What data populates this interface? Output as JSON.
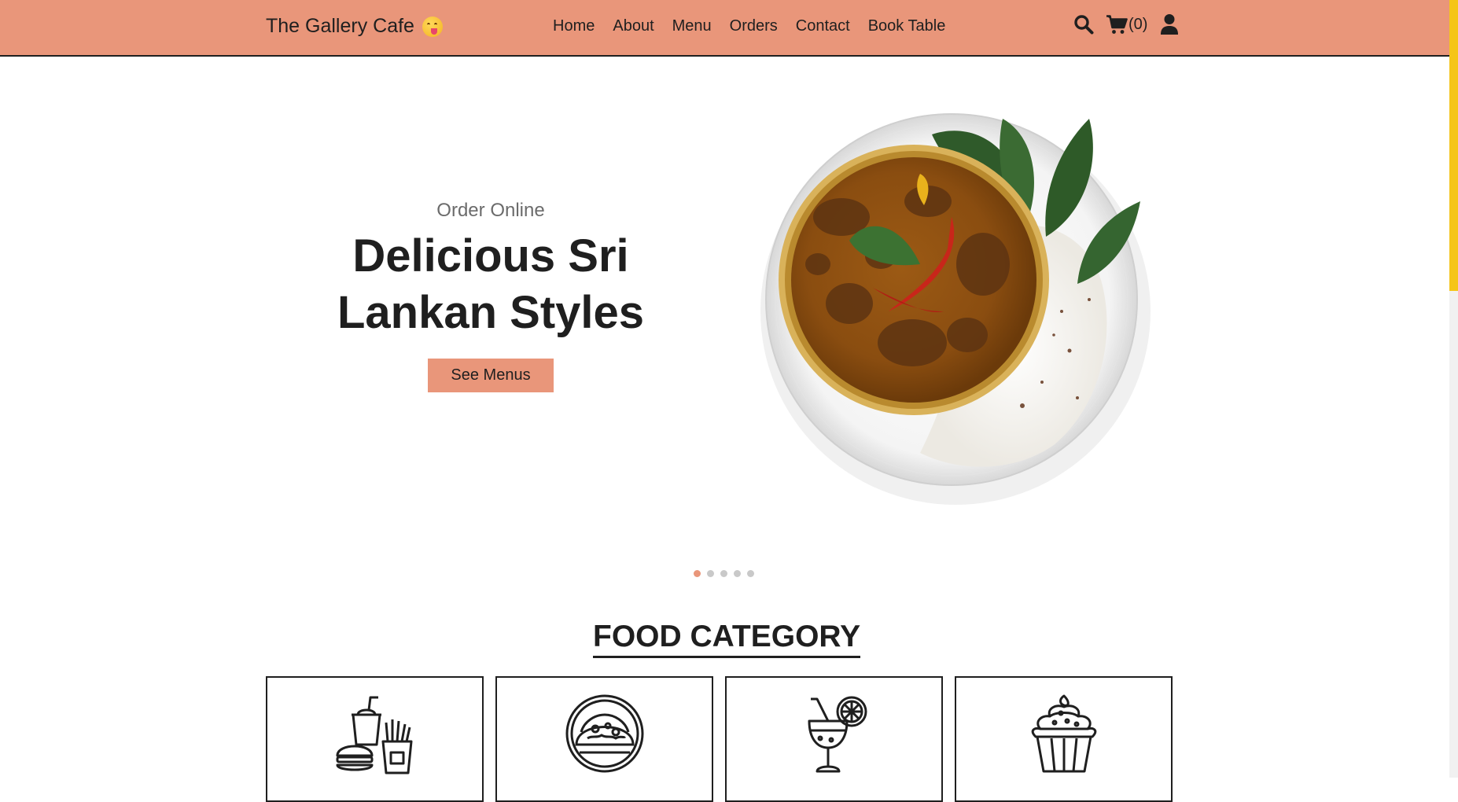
{
  "header": {
    "brand": "The Gallery Cafe",
    "brand_icon": "face-savoring-food-emoji",
    "nav": [
      "Home",
      "About",
      "Menu",
      "Orders",
      "Contact",
      "Book Table"
    ],
    "cart_count": "(0)",
    "background": "#e9967a"
  },
  "hero": {
    "eyebrow": "Order Online",
    "title_line1": "Delicious Sri",
    "title_line2": "Lankan Styles",
    "cta": "See Menus",
    "image": "sri-lankan-curry-and-rice-plate",
    "slides_total": 5,
    "active_slide": 1
  },
  "category": {
    "heading": "FOOD CATEGORY",
    "cards": [
      {
        "icon": "fast-food-icon"
      },
      {
        "icon": "taco-icon"
      },
      {
        "icon": "cocktail-icon"
      },
      {
        "icon": "cupcake-icon"
      }
    ]
  },
  "colors": {
    "accent": "#e9967a",
    "text": "#1f1f1f",
    "muted": "#6b6b6b",
    "scrollbar": "#f5c518"
  }
}
